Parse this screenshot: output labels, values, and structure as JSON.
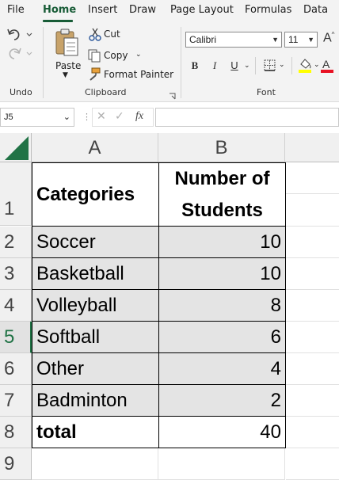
{
  "menu": {
    "tabs": [
      "File",
      "Home",
      "Insert",
      "Draw",
      "Page Layout",
      "Formulas",
      "Data"
    ],
    "active": "Home"
  },
  "ribbon": {
    "undo_group": {
      "label": "Undo"
    },
    "clipboard_group": {
      "label": "Clipboard",
      "paste_label": "Paste",
      "cut_label": "Cut",
      "copy_label": "Copy",
      "format_painter_label": "Format Painter"
    },
    "font_group": {
      "label": "Font",
      "font_name": "Calibri",
      "font_size": "11",
      "bold_label": "B",
      "italic_label": "I",
      "underline_label": "U"
    },
    "colors": {
      "highlight": "#ffff00",
      "font_color": "#e81123",
      "accent": "#185c37"
    }
  },
  "formula_bar": {
    "name_box": "J5",
    "fx_label": "fx",
    "value": ""
  },
  "sheet": {
    "columns": [
      "A",
      "B"
    ],
    "rows": [
      {
        "num": "1",
        "a": "Categories",
        "b": "Number of Students"
      },
      {
        "num": "2",
        "a": "Soccer",
        "b": "10"
      },
      {
        "num": "3",
        "a": "Basketball",
        "b": "10"
      },
      {
        "num": "4",
        "a": "Volleyball",
        "b": "8"
      },
      {
        "num": "5",
        "a": "Softball",
        "b": "6"
      },
      {
        "num": "6",
        "a": "Other",
        "b": "4"
      },
      {
        "num": "7",
        "a": "Badminton",
        "b": "2"
      },
      {
        "num": "8",
        "a": "total",
        "b": "40"
      },
      {
        "num": "9",
        "a": "",
        "b": ""
      }
    ],
    "selected_row": "5"
  }
}
